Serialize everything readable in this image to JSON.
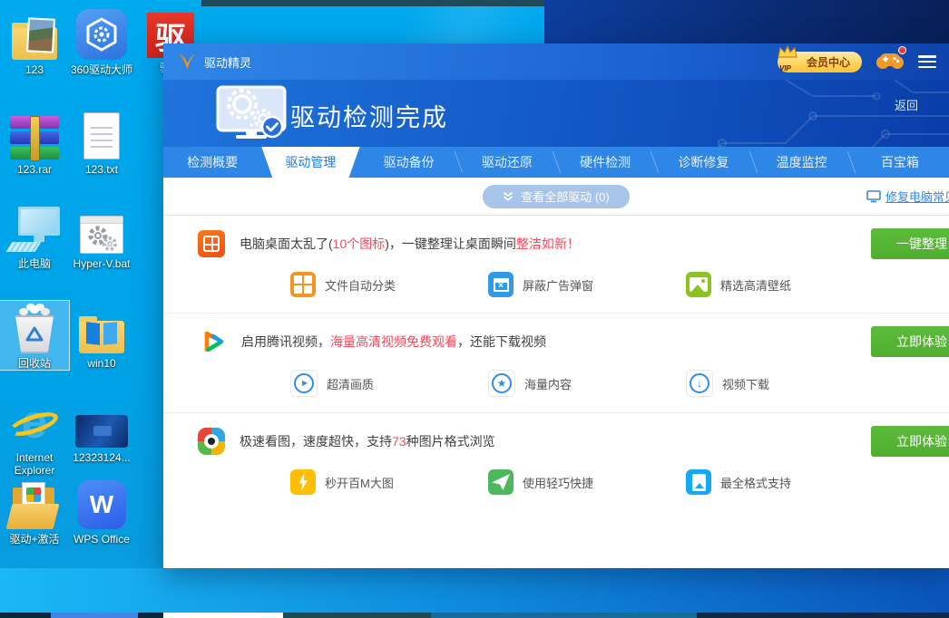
{
  "glyphs": {
    "wps": "W",
    "ie": "e",
    "qu_icon": "驱",
    "adblock_x": "×",
    "play": "▶",
    "star": "★",
    "down_arrow": "↓"
  },
  "colors": {
    "accent_blue": "#1a7ce8",
    "button_green": "#52b231",
    "highlight_red": "#f9465a",
    "vip_gold": "#fcc233"
  },
  "desktop": {
    "icons": [
      {
        "label": "123"
      },
      {
        "label": "360驱动大师"
      },
      {
        "label": "驱动"
      },
      {
        "label": "123.rar"
      },
      {
        "label": "123.txt"
      },
      {
        "label": "此电脑"
      },
      {
        "label": "Hyper-V.bat"
      },
      {
        "label": "回收站"
      },
      {
        "label": "win10"
      },
      {
        "label": "Internet Explorer"
      },
      {
        "label": "12323124..."
      },
      {
        "label": "驱动+激活"
      },
      {
        "label": "WPS Office"
      }
    ]
  },
  "app": {
    "brand": "驱动精灵",
    "vip_label": "会员中心",
    "vip_badge": "VIP",
    "back_label": "返回",
    "banner_title": "驱动检测完成",
    "tabs": [
      {
        "label": "检测概要"
      },
      {
        "label": "驱动管理",
        "active": true
      },
      {
        "label": "驱动备份"
      },
      {
        "label": "驱动还原"
      },
      {
        "label": "硬件检测"
      },
      {
        "label": "诊断修复"
      },
      {
        "label": "温度监控"
      },
      {
        "label": "百宝箱"
      }
    ],
    "toolbar": {
      "view_all": "查看全部驱动 (0)",
      "fix_link": "修复电脑常见"
    },
    "promos": [
      {
        "headline": [
          {
            "t": "电脑桌面太乱了("
          },
          {
            "t": "10个图标",
            "red": true
          },
          {
            "t": ")，一键整理让桌面瞬间"
          },
          {
            "t": "整洁如新！",
            "red": true
          }
        ],
        "features": [
          {
            "label": "文件自动分类"
          },
          {
            "label": "屏蔽广告弹窗"
          },
          {
            "label": "精选高清壁纸"
          }
        ],
        "button": "一键整理"
      },
      {
        "headline": [
          {
            "t": "启用腾讯视频，"
          },
          {
            "t": "海量高清视频免费观看",
            "red": true
          },
          {
            "t": "，还能下载视频"
          }
        ],
        "features": [
          {
            "label": "超清画质"
          },
          {
            "label": "海量内容"
          },
          {
            "label": "视频下载"
          }
        ],
        "button": "立即体验"
      },
      {
        "headline": [
          {
            "t": "极速看图，速度超快，支持"
          },
          {
            "t": "73",
            "red": true
          },
          {
            "t": "种图片格式浏览"
          }
        ],
        "features": [
          {
            "label": "秒开百M大图"
          },
          {
            "label": "使用轻巧快捷"
          },
          {
            "label": "最全格式支持"
          }
        ],
        "button": "立即体验"
      }
    ]
  }
}
